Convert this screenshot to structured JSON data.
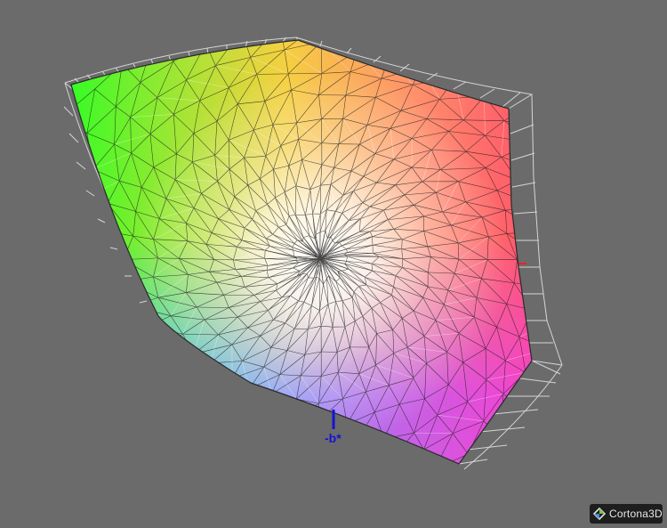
{
  "scene": {
    "background_color": "#6b6b6b",
    "axis_color": "#1414d2",
    "axis_label": "-b*",
    "marker_color": "#ff2020"
  },
  "viewer": {
    "logo_text": "Cortona3D"
  }
}
